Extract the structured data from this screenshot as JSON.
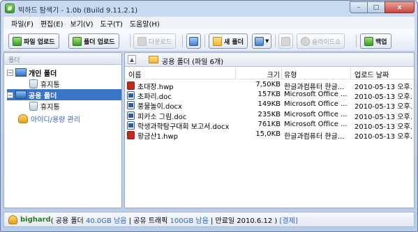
{
  "window": {
    "title": "빅하드 탐색기 - 1.0b (Build 9.11.2.1)",
    "buttons": {
      "minimize": "–",
      "maximize": "□",
      "close": "x"
    }
  },
  "menu": [
    {
      "label": "파일(F)"
    },
    {
      "label": "편집(E)"
    },
    {
      "label": "보기(V)"
    },
    {
      "label": "도구(T)"
    },
    {
      "label": "도움말(H)"
    }
  ],
  "toolbar": {
    "file_upload": "파일 업로드",
    "folder_upload": "폴더 업로드",
    "download": "다운로드",
    "new_folder": "새 폴더",
    "slideshow": "슬라이드쇼",
    "backup": "백업"
  },
  "left_panel": {
    "header": "폴더",
    "tree": [
      {
        "label": "개인 폴더",
        "expander": "−"
      },
      {
        "label": "휴지통"
      },
      {
        "label": "공용 폴더",
        "expander": "−"
      },
      {
        "label": "휴지통"
      },
      {
        "label": "아이디/용량 관리"
      }
    ]
  },
  "right_panel": {
    "path": "공용 폴더 (파일 6개)",
    "up_arrow": "▲",
    "columns": {
      "name": "이름",
      "size": "크기",
      "type": "유형",
      "date": "업로드 날짜"
    },
    "files": [
      {
        "name": "초대장.hwp",
        "size": "7,50KB",
        "type": "한글과컴퓨터 한글...",
        "date": "2010-05-13 오후...",
        "icon": "hwp-file-icon"
      },
      {
        "name": "초파리.doc",
        "size": "157KB",
        "type": "Microsoft Office ...",
        "date": "2010-05-13 오후...",
        "icon": "doc-file-icon"
      },
      {
        "name": "풍물놀이.docx",
        "size": "149KB",
        "type": "Microsoft Office ...",
        "date": "2010-05-13 오후...",
        "icon": "doc-file-icon"
      },
      {
        "name": "피카소 그림.doc",
        "size": "235KB",
        "type": "Microsoft Office ...",
        "date": "2010-05-13 오후...",
        "icon": "doc-file-icon"
      },
      {
        "name": "학생과학탐구대회 보고서.docx",
        "size": "761KB",
        "type": "Microsoft Office ...",
        "date": "2010-05-13 오후...",
        "icon": "doc-file-icon"
      },
      {
        "name": "황금산1.hwp",
        "size": "15,0KB",
        "type": "한글과컴퓨터 한글...",
        "date": "2010-05-13 오후...",
        "icon": "hwp-file-icon"
      }
    ]
  },
  "status": {
    "user": "bighard",
    "open": "( 공용 폴더 ",
    "folder_remaining": "40.0GB 남음",
    "sep1": " | 공유 트래픽 ",
    "traffic_remaining": "100GB 남음",
    "sep2": " | 만료일 2010.6.12 ) ",
    "payment": "[결제]"
  }
}
